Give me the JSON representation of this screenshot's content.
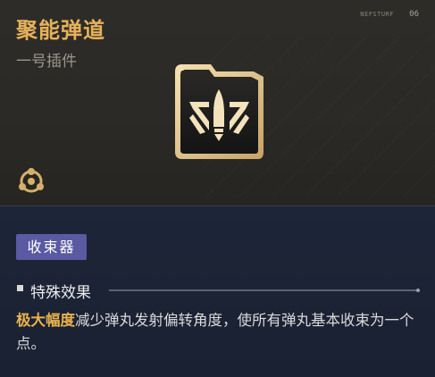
{
  "plugin": {
    "title": "聚能弹道",
    "subtitle": "一号插件",
    "corner_tag": "NEFSTURF",
    "corner_number": "06",
    "level": "1"
  },
  "icons": {
    "chip_symbol": "bullet-emblem-icon",
    "module": "hexagon-module-icon"
  },
  "tag_label": "收束器",
  "section": {
    "title": "特殊效果"
  },
  "effect": {
    "highlight": "极大幅度",
    "text": "减少弹丸发射偏转角度，使所有弹丸基本收束为一个点。"
  },
  "colors": {
    "title_gold": "#e6b25a",
    "badge_purple": "#5a5aa3",
    "highlight_gold": "#e8b24c",
    "bottom_bg": "#1d2538"
  }
}
